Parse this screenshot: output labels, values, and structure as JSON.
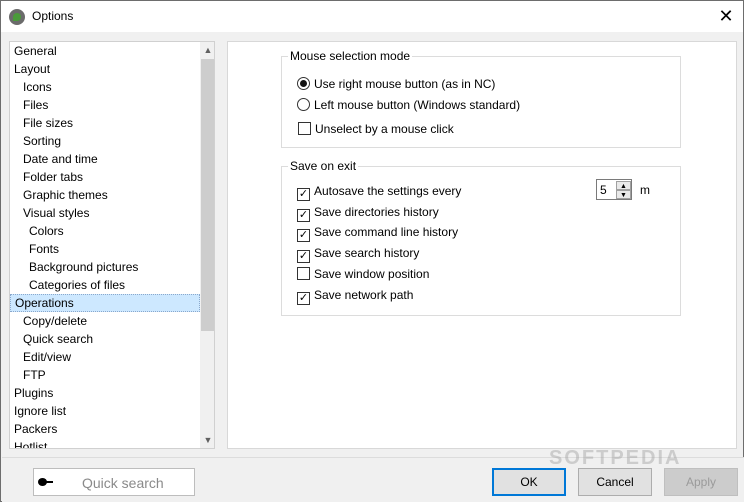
{
  "window": {
    "title": "Options",
    "close_glyph": "✕"
  },
  "tree": {
    "items": [
      {
        "label": "General",
        "level": 0
      },
      {
        "label": "Layout",
        "level": 0
      },
      {
        "label": "Icons",
        "level": 1
      },
      {
        "label": "Files",
        "level": 1
      },
      {
        "label": "File sizes",
        "level": 1
      },
      {
        "label": "Sorting",
        "level": 1
      },
      {
        "label": "Date and time",
        "level": 1
      },
      {
        "label": "Folder tabs",
        "level": 1
      },
      {
        "label": "Graphic themes",
        "level": 1
      },
      {
        "label": "Visual styles",
        "level": 1
      },
      {
        "label": "Colors",
        "level": 2
      },
      {
        "label": "Fonts",
        "level": 2
      },
      {
        "label": "Background pictures",
        "level": 2
      },
      {
        "label": "Categories of files",
        "level": 2
      },
      {
        "label": "Operations",
        "level": 0,
        "selected": true
      },
      {
        "label": "Copy/delete",
        "level": 1
      },
      {
        "label": "Quick search",
        "level": 1
      },
      {
        "label": "Edit/view",
        "level": 1
      },
      {
        "label": "FTP",
        "level": 1
      },
      {
        "label": "Plugins",
        "level": 0
      },
      {
        "label": "Ignore list",
        "level": 0
      },
      {
        "label": "Packers",
        "level": 0
      },
      {
        "label": "Hotlist",
        "level": 0
      }
    ]
  },
  "mouse_group": {
    "title": "Mouse selection mode",
    "radio_right": {
      "label": "Use right mouse button (as in NC)",
      "checked": true
    },
    "radio_left": {
      "label": "Left mouse button (Windows standard)",
      "checked": false
    },
    "unselect": {
      "label": "Unselect by a mouse click",
      "checked": false
    }
  },
  "save_group": {
    "title": "Save on exit",
    "options": [
      {
        "label": "Autosave the settings every",
        "checked": true
      },
      {
        "label": "Save directories history",
        "checked": true
      },
      {
        "label": "Save command line history",
        "checked": true
      },
      {
        "label": "Save search history",
        "checked": true
      },
      {
        "label": "Save window position",
        "checked": false
      },
      {
        "label": "Save network path",
        "checked": true
      }
    ],
    "autosave_value": "5",
    "autosave_unit": "m"
  },
  "footer": {
    "quick_search_placeholder": "Quick search",
    "ok_label": "OK",
    "cancel_label": "Cancel",
    "apply_label": "Apply",
    "watermark": "SOFTPEDIA"
  }
}
